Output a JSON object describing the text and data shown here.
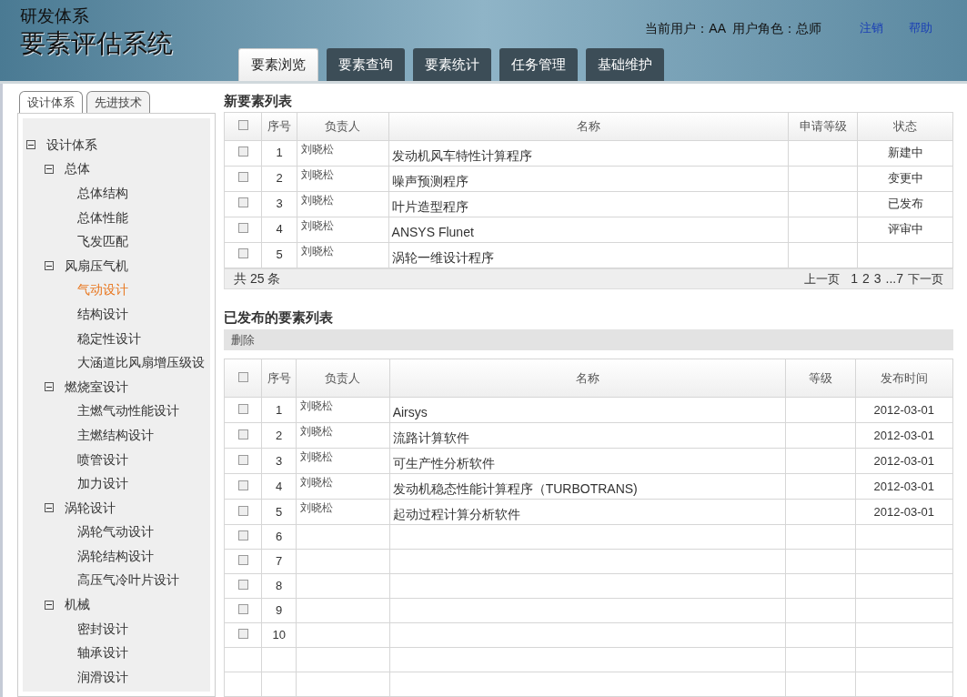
{
  "header": {
    "subtitle": "研发体系",
    "title": "要素评估系统",
    "user_info": "当前用户：AA  用户角色：总师",
    "links": [
      "注销",
      "帮助"
    ]
  },
  "nav_tabs": [
    {
      "label": "要素浏览",
      "selected": true
    },
    {
      "label": "要素查询",
      "selected": false
    },
    {
      "label": "要素统计",
      "selected": false
    },
    {
      "label": "任务管理",
      "selected": false
    },
    {
      "label": "基础维护",
      "selected": false
    }
  ],
  "sidebar": {
    "tabs": [
      {
        "label": "设计体系",
        "selected": true
      },
      {
        "label": "先进技术",
        "selected": false
      }
    ],
    "tree": [
      {
        "label": "设计体系",
        "expanded": true,
        "selected": false,
        "children": [
          {
            "label": "总体",
            "expanded": true,
            "selected": false,
            "children": [
              {
                "label": "总体结构",
                "selected": false
              },
              {
                "label": "总体性能",
                "selected": false
              },
              {
                "label": "飞发匹配",
                "selected": false
              }
            ]
          },
          {
            "label": "风扇压气机",
            "expanded": true,
            "selected": false,
            "children": [
              {
                "label": "气动设计",
                "selected": true
              },
              {
                "label": "结构设计",
                "selected": false
              },
              {
                "label": "稳定性设计",
                "selected": false
              },
              {
                "label": "大涵道比风扇增压级设",
                "selected": false
              }
            ]
          },
          {
            "label": "燃烧室设计",
            "expanded": true,
            "selected": false,
            "children": [
              {
                "label": "主燃气动性能设计",
                "selected": false
              },
              {
                "label": "主燃结构设计",
                "selected": false
              },
              {
                "label": "喷管设计",
                "selected": false
              },
              {
                "label": "加力设计",
                "selected": false
              }
            ]
          },
          {
            "label": "涡轮设计",
            "expanded": true,
            "selected": false,
            "children": [
              {
                "label": "涡轮气动设计",
                "selected": false
              },
              {
                "label": "涡轮结构设计",
                "selected": false
              },
              {
                "label": "高压气冷叶片设计",
                "selected": false
              }
            ]
          },
          {
            "label": "机械",
            "expanded": true,
            "selected": false,
            "children": [
              {
                "label": "密封设计",
                "selected": false
              },
              {
                "label": "轴承设计",
                "selected": false
              },
              {
                "label": "润滑设计",
                "selected": false
              }
            ]
          }
        ]
      }
    ]
  },
  "new_list": {
    "title": "新要素列表",
    "select_all_checked": false,
    "columns": [
      "序号",
      "负责人",
      "名称",
      "申请等级",
      "状态"
    ],
    "rows": [
      {
        "checked": false,
        "cells": [
          "1",
          "刘晓松",
          "发动机风车特性计算程序",
          "",
          "新建中"
        ]
      },
      {
        "checked": false,
        "cells": [
          "2",
          "刘晓松",
          "噪声预测程序",
          "",
          "变更中"
        ]
      },
      {
        "checked": false,
        "cells": [
          "3",
          "刘晓松",
          "叶片造型程序",
          "",
          "已发布"
        ]
      },
      {
        "checked": false,
        "cells": [
          "4",
          "刘晓松",
          "ANSYS Flunet",
          "",
          "评审中"
        ]
      },
      {
        "checked": false,
        "cells": [
          "5",
          "刘晓松",
          "涡轮一维设计程序",
          "",
          ""
        ]
      }
    ],
    "total": "共 25 条",
    "prev": "上一页",
    "pages": [
      "1",
      "2",
      "3",
      "...7"
    ],
    "next": "下一页"
  },
  "published_list": {
    "title": "已发布的要素列表",
    "select_all_checked": false,
    "toolbar_button": "删除",
    "columns": [
      "序号",
      "负责人",
      "名称",
      "等级",
      "发布时间"
    ],
    "rows": [
      {
        "checked": false,
        "cells": [
          "1",
          "刘晓松",
          "Airsys",
          "",
          "2012-03-01"
        ]
      },
      {
        "checked": false,
        "cells": [
          "2",
          "刘晓松",
          "流路计算软件",
          "",
          "2012-03-01"
        ]
      },
      {
        "checked": false,
        "cells": [
          "3",
          "刘晓松",
          "可生产性分析软件",
          "",
          "2012-03-01"
        ]
      },
      {
        "checked": false,
        "cells": [
          "4",
          "刘晓松",
          "发动机稳态性能计算程序（TURBOTRANS)",
          "",
          "2012-03-01"
        ]
      },
      {
        "checked": false,
        "cells": [
          "5",
          "刘晓松",
          "起动过程计算分析软件",
          "",
          "2012-03-01"
        ]
      },
      {
        "checked": false,
        "cells": [
          "6",
          "",
          "",
          "",
          ""
        ]
      },
      {
        "checked": false,
        "cells": [
          "7",
          "",
          "",
          "",
          ""
        ]
      },
      {
        "checked": false,
        "cells": [
          "8",
          "",
          "",
          "",
          ""
        ]
      },
      {
        "checked": false,
        "cells": [
          "9",
          "",
          "",
          "",
          ""
        ]
      },
      {
        "checked": false,
        "cells": [
          "10",
          "",
          "",
          "",
          ""
        ]
      }
    ]
  }
}
